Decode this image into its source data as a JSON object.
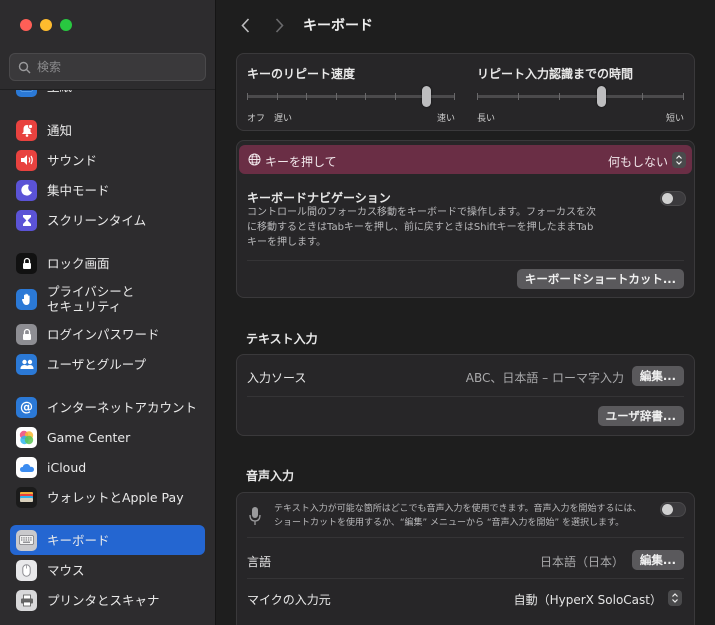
{
  "sidebar": {
    "search_placeholder": "検索",
    "items": [
      {
        "label": "壁紙",
        "icon": "wallpaper-icon",
        "color": "#2b79d6"
      },
      {
        "label": "通知",
        "icon": "notifications-icon",
        "color": "#e8423f"
      },
      {
        "label": "サウンド",
        "icon": "sound-icon",
        "color": "#e8423f"
      },
      {
        "label": "集中モード",
        "icon": "focus-moon-icon",
        "color": "#5b53d6"
      },
      {
        "label": "スクリーンタイム",
        "icon": "screen-time-hourglass-icon",
        "color": "#5b53d6"
      },
      {
        "label": "ロック画面",
        "icon": "lock-screen-icon",
        "color": "#1b1b1b"
      },
      {
        "label": "プライバシーと\nセキュリティ",
        "icon": "privacy-hand-icon",
        "color": "#2b79d6"
      },
      {
        "label": "ログインパスワード",
        "icon": "lock-icon",
        "color": "#8e8e93"
      },
      {
        "label": "ユーザとグループ",
        "icon": "users-icon",
        "color": "#2b79d6"
      },
      {
        "label": "インターネットアカウント",
        "icon": "at-sign-icon",
        "color": "#2b79d6"
      },
      {
        "label": "Game Center",
        "icon": "game-center-icon",
        "color": "#ffffff"
      },
      {
        "label": "iCloud",
        "icon": "icloud-icon",
        "color": "#ffffff"
      },
      {
        "label": "ウォレットとApple Pay",
        "icon": "wallet-icon",
        "color": "#1b1b1b"
      },
      {
        "label": "キーボード",
        "icon": "keyboard-icon",
        "color": "#8e8e93"
      },
      {
        "label": "マウス",
        "icon": "mouse-icon",
        "color": "#8e8e93"
      },
      {
        "label": "プリンタとスキャナ",
        "icon": "printer-icon",
        "color": "#8e8e93"
      }
    ]
  },
  "main": {
    "title": "キーボード",
    "repeat": {
      "title": "キーのリピート速度",
      "left_label": "オフ",
      "slow_label": "遅い",
      "fast_label": "速い",
      "value_fraction": 0.86
    },
    "delay": {
      "title": "リピート入力認識までの時間",
      "long_label": "長い",
      "short_label": "短い",
      "value_fraction": 0.6
    },
    "globe_key": {
      "label": "キーを押して",
      "value": "何もしない"
    },
    "keyboard_nav": {
      "title": "キーボードナビゲーション",
      "description_lines": [
        "コントロール間のフォーカス移動をキーボードで操作します。フォーカスを次",
        "に移動するときはTabキーを押し、前に戻すときはShiftキーを押したままTab",
        "キーを押します。"
      ],
      "enabled": false
    },
    "shortcuts_button": "キーボードショートカット...",
    "text_input": {
      "section_title": "テキスト入力",
      "input_sources_label": "入力ソース",
      "input_sources_value": "ABC、日本語 – ローマ字入力",
      "edit_button": "編集...",
      "user_dict_button": "ユーザ辞書..."
    },
    "dictation": {
      "section_title": "音声入力",
      "description_lines": [
        "テキスト入力が可能な箇所はどこでも音声入力を使用できます。音声入力を開始するには、",
        "ショートカットを使用するか、“編集” メニューから “音声入力を開始” を選択します。"
      ],
      "enabled": false,
      "language_label": "言語",
      "language_value": "日本語（日本）",
      "language_edit_button": "編集...",
      "mic_label": "マイクの入力元",
      "mic_value": "自動（HyperX SoloCast）"
    }
  },
  "colors": {
    "accent": "#2466d1",
    "highlight": "#6a2e45"
  }
}
